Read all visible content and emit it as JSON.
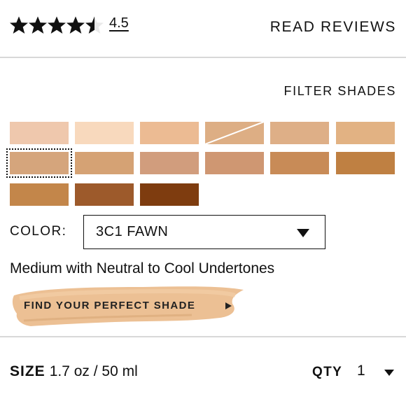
{
  "rating": {
    "value_text": "4.5",
    "stars_filled": 4.5,
    "stars_total": 5,
    "read_reviews_label": "READ REVIEWS"
  },
  "shades": {
    "filter_label": "FILTER SHADES",
    "swatches": [
      {
        "color": "#efc8ad",
        "selected": false
      },
      {
        "color": "#f8d9bd",
        "selected": false
      },
      {
        "color": "#ecbb93",
        "selected": false
      },
      {
        "color": "#ddae84",
        "selected": false,
        "unavailable": true
      },
      {
        "color": "#deaf87",
        "selected": false
      },
      {
        "color": "#e2b283",
        "selected": false
      },
      {
        "color": "#d5a57c",
        "selected": true
      },
      {
        "color": "#d5a274",
        "selected": false
      },
      {
        "color": "#d19d7d",
        "selected": false
      },
      {
        "color": "#cf9772",
        "selected": false
      },
      {
        "color": "#c88b57",
        "selected": false
      },
      {
        "color": "#bf8042",
        "selected": false
      },
      {
        "color": "#c3864a",
        "selected": false
      },
      {
        "color": "#9d5a2b",
        "selected": false
      },
      {
        "color": "#7e3c0f",
        "selected": false
      }
    ]
  },
  "color_select": {
    "label": "COLOR:",
    "value": "3C1 FAWN"
  },
  "shade_description": "Medium with Neutral to Cool Undertones",
  "find_shade_label": "FIND YOUR PERFECT SHADE",
  "purchase": {
    "size_label": "SIZE",
    "size_value": "1.7 oz / 50 ml",
    "qty_label": "QTY",
    "qty_value": "1"
  }
}
